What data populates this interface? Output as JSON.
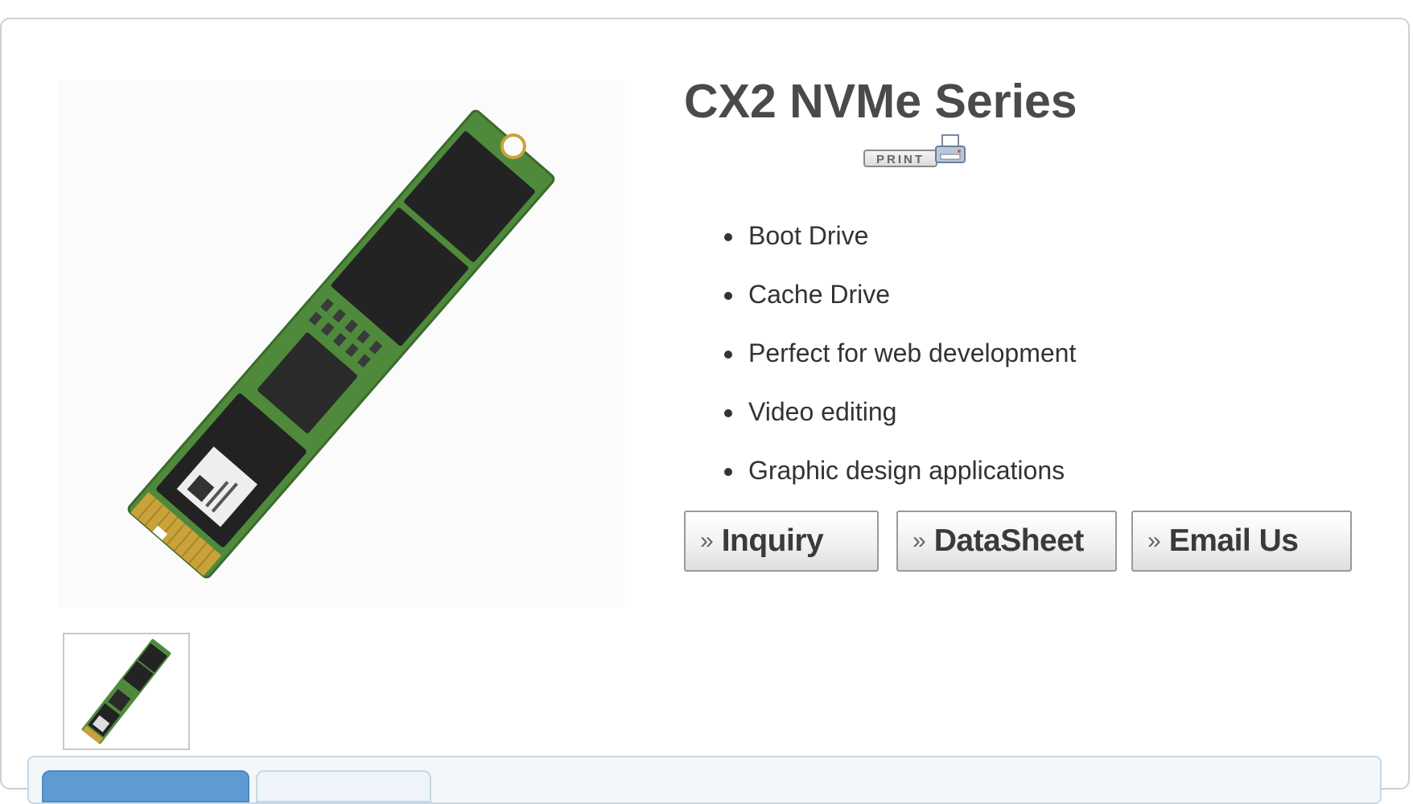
{
  "product": {
    "title": "CX2 NVMe Series",
    "print_label": "PRINT",
    "features": [
      "Boot Drive",
      "Cache Drive",
      "Perfect for web development",
      "Video editing",
      "Graphic design applications"
    ]
  },
  "actions": {
    "arrow_glyph": "»",
    "inquiry_label": "Inquiry",
    "datasheet_label": "DataSheet",
    "email_label": "Email Us"
  },
  "tabs": [
    {
      "label": "",
      "active": true
    },
    {
      "label": "",
      "active": false
    }
  ],
  "colors": {
    "pcb_green": "#4f8a3c",
    "chip_black": "#222222",
    "gold_contacts": "#c9a33a",
    "tab_active": "#5f9bd3"
  },
  "icons": {
    "print": "printer-icon",
    "arrow": "double-chevron-right-icon"
  }
}
